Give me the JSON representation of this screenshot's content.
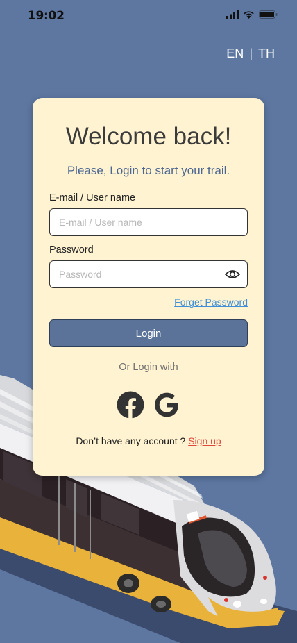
{
  "status": {
    "time": "19:02"
  },
  "language": {
    "en": "EN",
    "separator": "|",
    "th": "TH"
  },
  "card": {
    "title": "Welcome back!",
    "subtitle": "Please, Login to start your trail.",
    "username": {
      "label": "E-mail / User name",
      "placeholder": "E-mail / User name",
      "value": ""
    },
    "password": {
      "label": "Password",
      "placeholder": "Password",
      "value": ""
    },
    "forgot": "Forget Password",
    "login": "Login",
    "or": "Or Login with",
    "signup_prompt": "Don’t have any account ? ",
    "signup": "Sign up"
  },
  "icons": [
    "signal-icon",
    "wifi-icon",
    "battery-icon",
    "eye-icon",
    "facebook-icon",
    "google-icon"
  ],
  "colors": {
    "background": "#5d77a1",
    "card": "#fff3d1",
    "button": "#5b7299",
    "link": "#3f8fd8",
    "signup": "#e2473b"
  }
}
